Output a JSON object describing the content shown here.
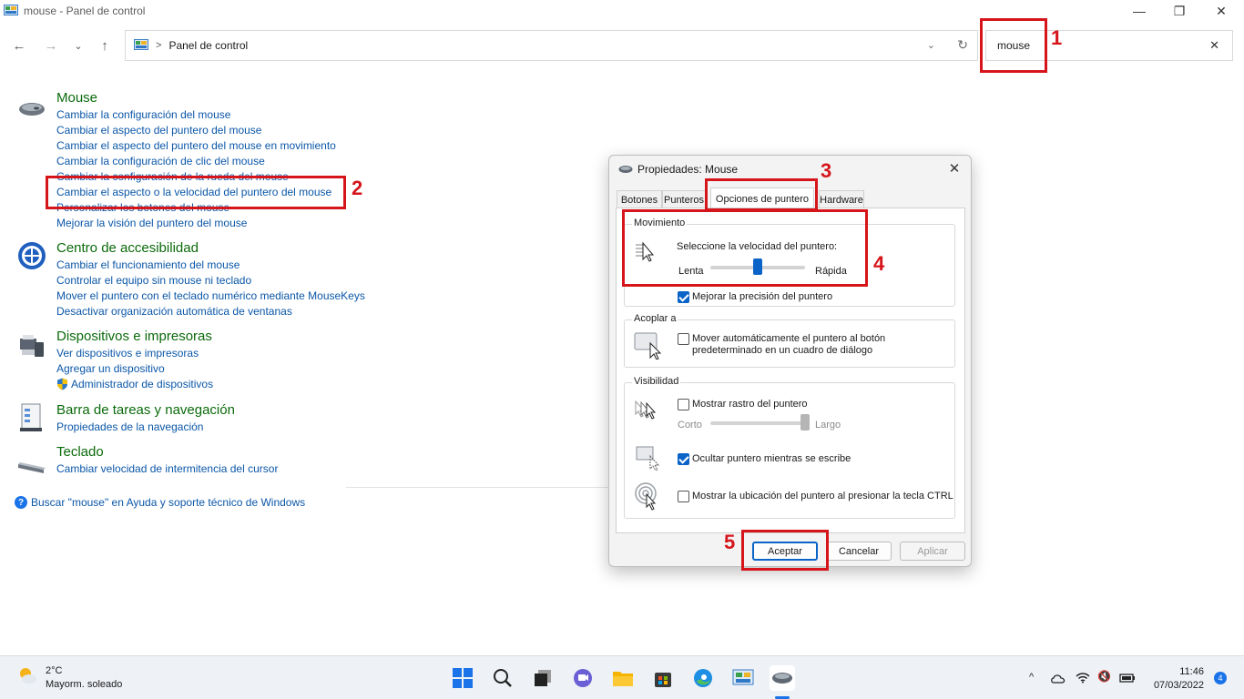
{
  "window": {
    "title": "mouse - Panel de control",
    "minimize_icon": "—",
    "restore_icon": "❐",
    "close_icon": "✕"
  },
  "nav": {
    "back_icon": "←",
    "forward_icon": "→",
    "recent_icon": "⌄",
    "up_icon": "↑",
    "breadcrumb_sep": ">",
    "breadcrumb": "Panel de control",
    "dropdown_icon": "⌄",
    "refresh_icon": "↻"
  },
  "search": {
    "query": "mouse",
    "clear_icon": "✕"
  },
  "results": {
    "mouse": {
      "title": "Mouse",
      "links": [
        "Cambiar la configuración del mouse",
        "Cambiar el aspecto del puntero del mouse",
        "Cambiar el aspecto del puntero del mouse en movimiento",
        "Cambiar la configuración de clic del mouse",
        "Cambiar la configuración de la rueda del mouse",
        "Cambiar el aspecto o la velocidad del puntero del mouse",
        "Personalizar los botones del mouse",
        "Mejorar la visión del puntero del mouse"
      ]
    },
    "accesibilidad": {
      "title": "Centro de accesibilidad",
      "links": [
        "Cambiar el funcionamiento del mouse",
        "Controlar el equipo sin mouse ni teclado",
        "Mover el puntero con el teclado numérico mediante MouseKeys",
        "Desactivar organización automática de ventanas"
      ]
    },
    "dispositivos": {
      "title": "Dispositivos e impresoras",
      "links": [
        "Ver dispositivos e impresoras",
        "Agregar un dispositivo",
        "Administrador de dispositivos"
      ]
    },
    "barra": {
      "title": "Barra de tareas y navegación",
      "links": [
        "Propiedades de la navegación"
      ]
    },
    "teclado": {
      "title": "Teclado",
      "links": [
        "Cambiar velocidad de intermitencia del cursor"
      ]
    },
    "help_icon": "?",
    "help": "Buscar \"mouse\" en Ayuda y soporte técnico de Windows"
  },
  "annotations": [
    "1",
    "2",
    "3",
    "4",
    "5"
  ],
  "dialog": {
    "title": "Propiedades: Mouse",
    "close_icon": "✕",
    "tabs": [
      "Botones",
      "Punteros",
      "Opciones de puntero",
      "Hardware"
    ],
    "active_tab": "Opciones de puntero",
    "movimiento": {
      "label": "Movimiento",
      "speed_label": "Seleccione la velocidad del puntero:",
      "slow": "Lenta",
      "fast": "Rápida",
      "speed_value": 0.5,
      "precision_label": "Mejorar la precisión del puntero",
      "precision_checked": true
    },
    "acoplar": {
      "label": "Acoplar a",
      "text_line1": "Mover automáticamente el puntero al botón",
      "text_line2": "predeterminado en un cuadro de diálogo",
      "checked": false
    },
    "visibilidad": {
      "label": "Visibilidad",
      "trail_label": "Mostrar rastro del puntero",
      "trail_checked": false,
      "short": "Corto",
      "long": "Largo",
      "trail_value": 1.0,
      "hide_label": "Ocultar puntero mientras se escribe",
      "hide_checked": true,
      "ctrl_label": "Mostrar la ubicación del puntero al presionar la tecla CTRL",
      "ctrl_checked": false
    },
    "buttons": {
      "ok": "Aceptar",
      "cancel": "Cancelar",
      "apply": "Aplicar"
    }
  },
  "taskbar": {
    "temperature": "2°C",
    "weather": "Mayorm. soleado",
    "time": "11:46",
    "date": "07/03/2022",
    "notifications": "4",
    "tray_chevron": "^",
    "tray_volume": "🔇"
  },
  "colors": {
    "section_title": "#0b6a0b",
    "link": "#0b57a8",
    "annotation": "#d6151b",
    "accent": "#0a64c8"
  }
}
